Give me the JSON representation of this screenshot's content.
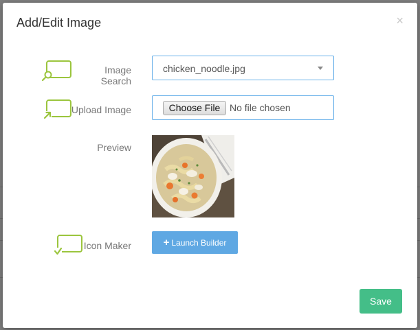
{
  "modal": {
    "title": "Add/Edit Image",
    "close_symbol": "×"
  },
  "fields": {
    "image_search": {
      "label": "Image Search",
      "icon": "image-search-icon",
      "value": "chicken_noodle.jpg"
    },
    "upload_image": {
      "label": "Upload Image",
      "icon": "upload-image-icon",
      "button_label": "Choose File",
      "status": "No file chosen"
    },
    "preview": {
      "label": "Preview",
      "image": "chicken noodle soup photo"
    },
    "icon_maker": {
      "label": "Icon Maker",
      "icon": "icon-maker-icon",
      "button_label": "Launch Builder"
    }
  },
  "footer": {
    "save_label": "Save"
  },
  "colors": {
    "accent_icon": "#9bc53d",
    "input_border": "#66afe9",
    "launch_button": "#5fa8e3",
    "save_button": "#44be88"
  }
}
